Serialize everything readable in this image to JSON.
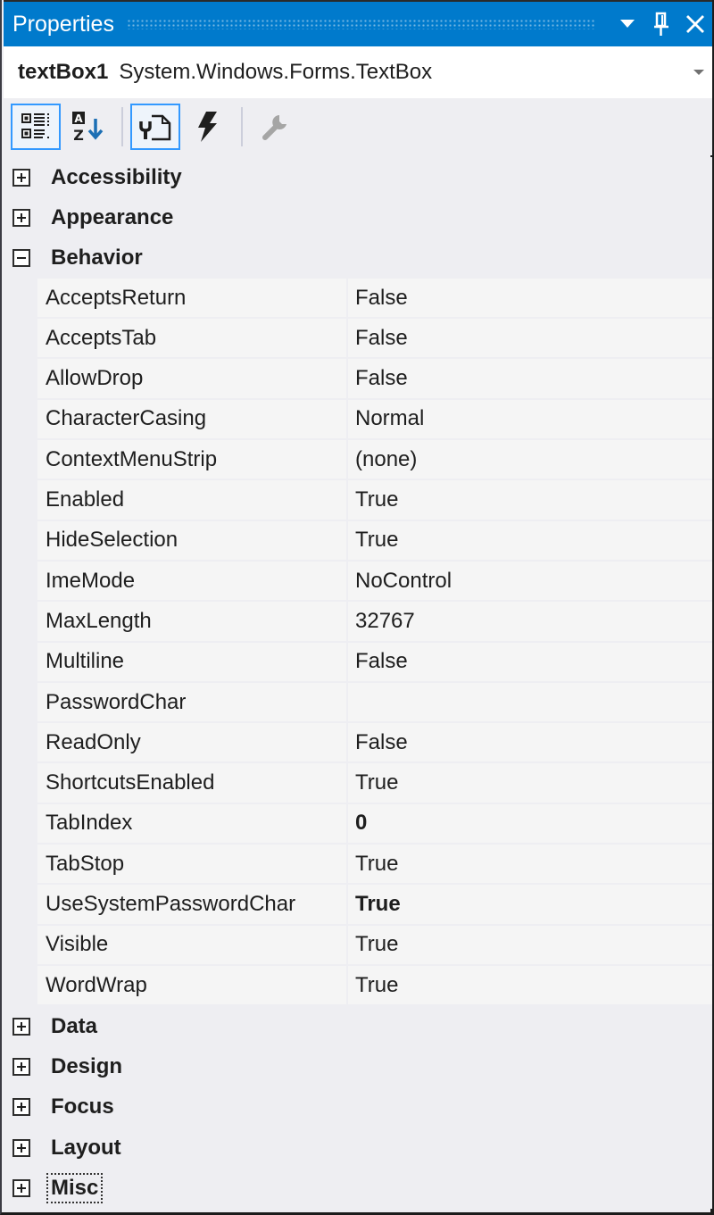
{
  "window": {
    "title": "Properties",
    "buttons": [
      {
        "name": "window-position-dropdown",
        "icon": "triangle-down-icon"
      },
      {
        "name": "auto-hide-pin",
        "icon": "pin-icon"
      },
      {
        "name": "close",
        "icon": "close-icon"
      }
    ]
  },
  "object_selector": {
    "object_name": "textBox1",
    "object_type": "System.Windows.Forms.TextBox"
  },
  "toolbar": {
    "buttons": [
      {
        "name": "categorized",
        "icon": "categorized-icon",
        "active": true
      },
      {
        "name": "alphabetical",
        "icon": "sort-az-icon",
        "active": false
      },
      {
        "name": "properties",
        "icon": "properties-icon",
        "active": true
      },
      {
        "name": "events",
        "icon": "lightning-icon",
        "active": false
      },
      {
        "name": "property-pages",
        "icon": "wrench-icon",
        "active": false,
        "disabled": true
      }
    ]
  },
  "categories": [
    {
      "label": "Accessibility",
      "expanded": false
    },
    {
      "label": "Appearance",
      "expanded": false
    },
    {
      "label": "Behavior",
      "expanded": true,
      "properties": [
        {
          "name": "AcceptsReturn",
          "value": "False",
          "modified": false
        },
        {
          "name": "AcceptsTab",
          "value": "False",
          "modified": false
        },
        {
          "name": "AllowDrop",
          "value": "False",
          "modified": false
        },
        {
          "name": "CharacterCasing",
          "value": "Normal",
          "modified": false
        },
        {
          "name": "ContextMenuStrip",
          "value": "(none)",
          "modified": false
        },
        {
          "name": "Enabled",
          "value": "True",
          "modified": false
        },
        {
          "name": "HideSelection",
          "value": "True",
          "modified": false
        },
        {
          "name": "ImeMode",
          "value": "NoControl",
          "modified": false
        },
        {
          "name": "MaxLength",
          "value": "32767",
          "modified": false
        },
        {
          "name": "Multiline",
          "value": "False",
          "modified": false
        },
        {
          "name": "PasswordChar",
          "value": "",
          "modified": false
        },
        {
          "name": "ReadOnly",
          "value": "False",
          "modified": false
        },
        {
          "name": "ShortcutsEnabled",
          "value": "True",
          "modified": false
        },
        {
          "name": "TabIndex",
          "value": "0",
          "modified": true
        },
        {
          "name": "TabStop",
          "value": "True",
          "modified": false
        },
        {
          "name": "UseSystemPasswordChar",
          "value": "True",
          "modified": true
        },
        {
          "name": "Visible",
          "value": "True",
          "modified": false
        },
        {
          "name": "WordWrap",
          "value": "True",
          "modified": false
        }
      ]
    },
    {
      "label": "Data",
      "expanded": false
    },
    {
      "label": "Design",
      "expanded": false
    },
    {
      "label": "Focus",
      "expanded": false
    },
    {
      "label": "Layout",
      "expanded": false
    },
    {
      "label": "Misc",
      "expanded": false,
      "focused": true
    }
  ],
  "colors": {
    "accent": "#007acc",
    "toolbar_active_border": "#3399ff",
    "background": "#eeeef2",
    "row_background": "#f5f5f5"
  }
}
